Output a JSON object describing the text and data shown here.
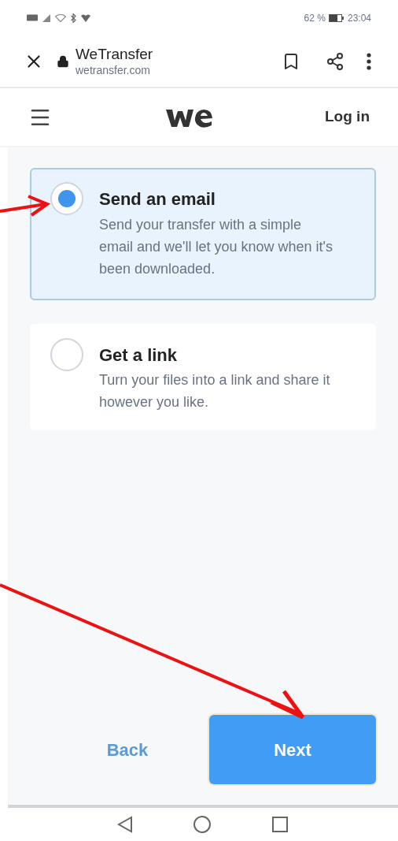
{
  "status_bar": {
    "battery": "62 %",
    "time": "23:04"
  },
  "browser_bar": {
    "title": "WeTransfer",
    "url": "wetransfer.com"
  },
  "header": {
    "login": "Log in"
  },
  "options": [
    {
      "title": "Send an email",
      "description": "Send your transfer with a simple email and we'll let you know when it's been downloaded.",
      "selected": true
    },
    {
      "title": "Get a link",
      "description": "Turn your files into a link and share it however you like.",
      "selected": false
    }
  ],
  "buttons": {
    "back": "Back",
    "next": "Next"
  }
}
